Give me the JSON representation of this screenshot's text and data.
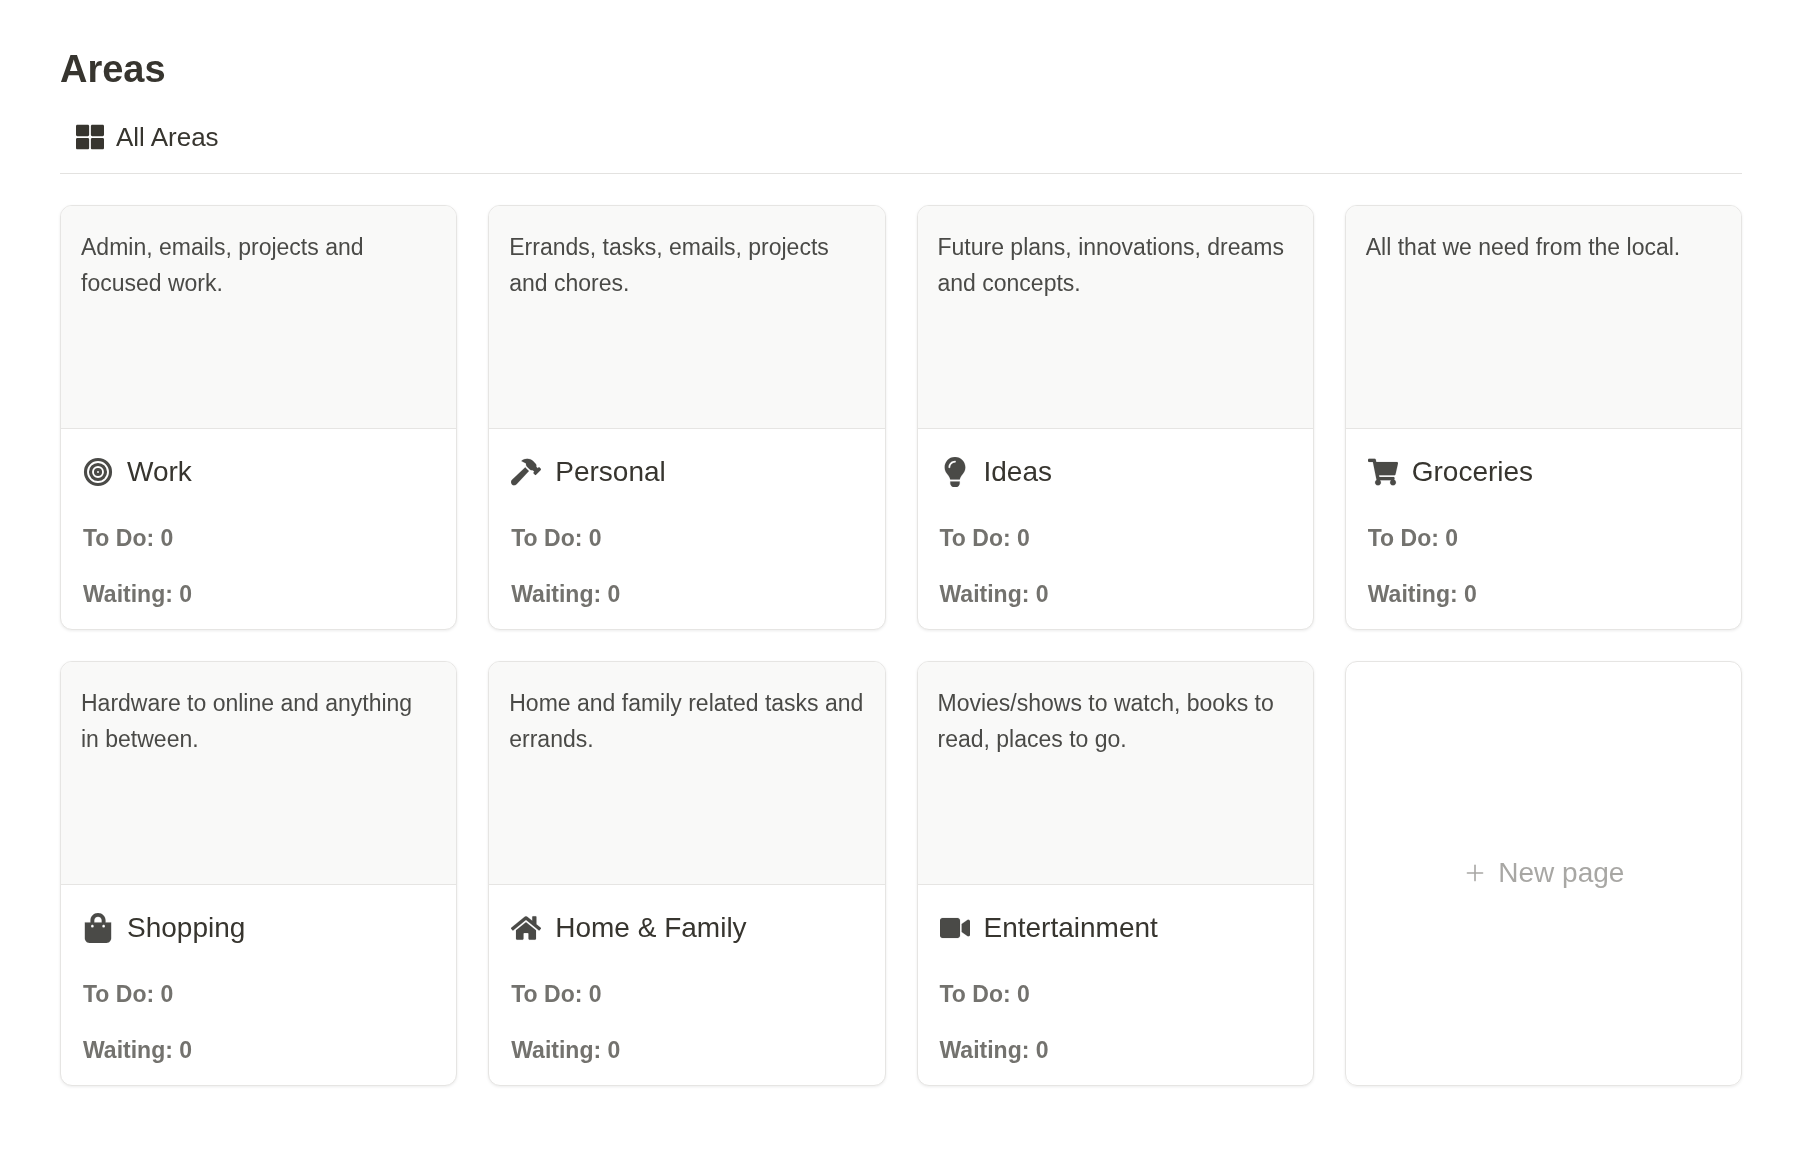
{
  "title": "Areas",
  "view_tab": {
    "label": "All Areas",
    "selected": true
  },
  "cards": [
    {
      "description": "Admin, emails, projects and focused work.",
      "name": "Work",
      "todo": "To Do: 0",
      "waiting": "Waiting: 0"
    },
    {
      "description": "Errands, tasks, emails, projects and chores.",
      "name": "Personal",
      "todo": "To Do: 0",
      "waiting": "Waiting: 0"
    },
    {
      "description": "Future plans, innovations, dreams and concepts.",
      "name": "Ideas",
      "todo": "To Do: 0",
      "waiting": "Waiting: 0"
    },
    {
      "description": "All that we need from the local.",
      "name": "Groceries",
      "todo": "To Do: 0",
      "waiting": "Waiting: 0"
    },
    {
      "description": "Hardware to online and anything in between.",
      "name": "Shopping",
      "todo": "To Do: 0",
      "waiting": "Waiting: 0"
    },
    {
      "description": "Home and family related tasks and errands.",
      "name": "Home & Family",
      "todo": "To Do: 0",
      "waiting": "Waiting: 0"
    },
    {
      "description": "Movies/shows to watch, books to read, places to go.",
      "name": "Entertainment",
      "todo": "To Do: 0",
      "waiting": "Waiting: 0"
    }
  ],
  "new_page": "New page"
}
